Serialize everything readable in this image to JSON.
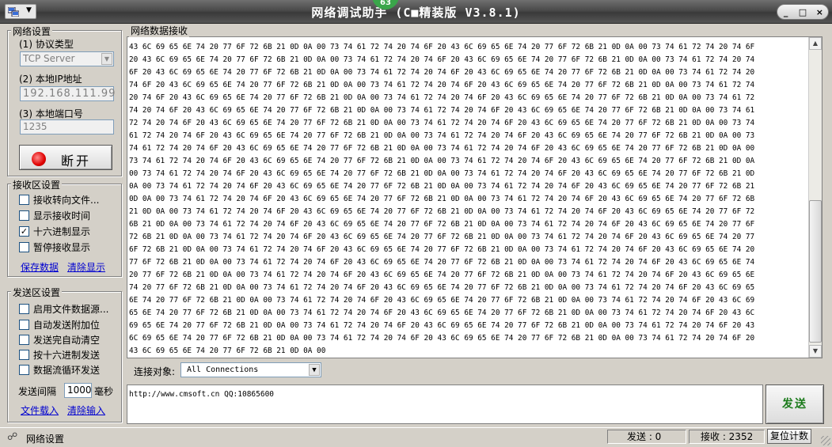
{
  "window": {
    "title": "网络调试助手 (C■精装版 V3.8.1)",
    "badge": "63",
    "min_glyph": "_",
    "max_glyph": "□",
    "close_glyph": "×"
  },
  "network": {
    "group_title": "网络设置",
    "protocol_label": "(1) 协议类型",
    "protocol_value": "TCP Server",
    "ip_label": "(2) 本地IP地址",
    "ip_value": "192.168.111.99",
    "port_label": "(3) 本地端口号",
    "port_value": "1235",
    "disconnect_label": "断开"
  },
  "receive_settings": {
    "group_title": "接收区设置",
    "options": [
      {
        "label": "接收转向文件...",
        "checked": false
      },
      {
        "label": "显示接收时间",
        "checked": false
      },
      {
        "label": "十六进制显示",
        "checked": true
      },
      {
        "label": "暂停接收显示",
        "checked": false
      }
    ],
    "save_link": "保存数据",
    "clear_link": "清除显示"
  },
  "send_settings": {
    "group_title": "发送区设置",
    "options": [
      {
        "label": "启用文件数据源...",
        "checked": false
      },
      {
        "label": "自动发送附加位",
        "checked": false
      },
      {
        "label": "发送完自动清空",
        "checked": false
      },
      {
        "label": "按十六进制发送",
        "checked": false
      },
      {
        "label": "数据流循环发送",
        "checked": false
      }
    ],
    "interval_label": "发送间隔",
    "interval_value": "1000",
    "interval_unit": "毫秒",
    "load_file_link": "文件载入",
    "clear_input_link": "清除输入"
  },
  "receive_area": {
    "title": "网络数据接收",
    "lines": [
      "43 6C 69 65 6E 74 20 77 6F 72 6B 21 0D 0A 00 73 74 61 72 74 20 74 6F 20 43 6C 69 65 6E 74 20 77 6F 72 6B 21 0D 0A 00 73 74 61 72 74 20 74 6F",
      "20 43 6C 69 65 6E 74 20 77 6F 72 6B 21 0D 0A 00 73 74 61 72 74 20 74 6F 20 43 6C 69 65 6E 74 20 77 6F 72 6B 21 0D 0A 00 73 74 61 72 74 20 74",
      "6F 20 43 6C 69 65 6E 74 20 77 6F 72 6B 21 0D 0A 00 73 74 61 72 74 20 74 6F 20 43 6C 69 65 6E 74 20 77 6F 72 6B 21 0D 0A 00 73 74 61 72 74 20",
      "74 6F 20 43 6C 69 65 6E 74 20 77 6F 72 6B 21 0D 0A 00 73 74 61 72 74 20 74 6F 20 43 6C 69 65 6E 74 20 77 6F 72 6B 21 0D 0A 00 73 74 61 72 74",
      "20 74 6F 20 43 6C 69 65 6E 74 20 77 6F 72 6B 21 0D 0A 00 73 74 61 72 74 20 74 6F 20 43 6C 69 65 6E 74 20 77 6F 72 6B 21 0D 0A 00 73 74 61 72",
      "74 20 74 6F 20 43 6C 69 65 6E 74 20 77 6F 72 6B 21 0D 0A 00 73 74 61 72 74 20 74 6F 20 43 6C 69 65 6E 74 20 77 6F 72 6B 21 0D 0A 00 73 74 61",
      "72 74 20 74 6F 20 43 6C 69 65 6E 74 20 77 6F 72 6B 21 0D 0A 00 73 74 61 72 74 20 74 6F 20 43 6C 69 65 6E 74 20 77 6F 72 6B 21 0D 0A 00 73 74",
      "61 72 74 20 74 6F 20 43 6C 69 65 6E 74 20 77 6F 72 6B 21 0D 0A 00 73 74 61 72 74 20 74 6F 20 43 6C 69 65 6E 74 20 77 6F 72 6B 21 0D 0A 00 73",
      "74 61 72 74 20 74 6F 20 43 6C 69 65 6E 74 20 77 6F 72 6B 21 0D 0A 00 73 74 61 72 74 20 74 6F 20 43 6C 69 65 6E 74 20 77 6F 72 6B 21 0D 0A 00",
      "73 74 61 72 74 20 74 6F 20 43 6C 69 65 6E 74 20 77 6F 72 6B 21 0D 0A 00 73 74 61 72 74 20 74 6F 20 43 6C 69 65 6E 74 20 77 6F 72 6B 21 0D 0A",
      "00 73 74 61 72 74 20 74 6F 20 43 6C 69 65 6E 74 20 77 6F 72 6B 21 0D 0A 00 73 74 61 72 74 20 74 6F 20 43 6C 69 65 6E 74 20 77 6F 72 6B 21 0D",
      "0A 00 73 74 61 72 74 20 74 6F 20 43 6C 69 65 6E 74 20 77 6F 72 6B 21 0D 0A 00 73 74 61 72 74 20 74 6F 20 43 6C 69 65 6E 74 20 77 6F 72 6B 21",
      "0D 0A 00 73 74 61 72 74 20 74 6F 20 43 6C 69 65 6E 74 20 77 6F 72 6B 21 0D 0A 00 73 74 61 72 74 20 74 6F 20 43 6C 69 65 6E 74 20 77 6F 72 6B",
      "21 0D 0A 00 73 74 61 72 74 20 74 6F 20 43 6C 69 65 6E 74 20 77 6F 72 6B 21 0D 0A 00 73 74 61 72 74 20 74 6F 20 43 6C 69 65 6E 74 20 77 6F 72",
      "6B 21 0D 0A 00 73 74 61 72 74 20 74 6F 20 43 6C 69 65 6E 74 20 77 6F 72 6B 21 0D 0A 00 73 74 61 72 74 20 74 6F 20 43 6C 69 65 6E 74 20 77 6F",
      "72 6B 21 0D 0A 00 73 74 61 72 74 20 74 6F 20 43 6C 69 65 6E 74 20 77 6F 72 6B 21 0D 0A 00 73 74 61 72 74 20 74 6F 20 43 6C 69 65 6E 74 20 77",
      "6F 72 6B 21 0D 0A 00 73 74 61 72 74 20 74 6F 20 43 6C 69 65 6E 74 20 77 6F 72 6B 21 0D 0A 00 73 74 61 72 74 20 74 6F 20 43 6C 69 65 6E 74 20",
      "77 6F 72 6B 21 0D 0A 00 73 74 61 72 74 20 74 6F 20 43 6C 69 65 6E 74 20 77 6F 72 6B 21 0D 0A 00 73 74 61 72 74 20 74 6F 20 43 6C 69 65 6E 74",
      "20 77 6F 72 6B 21 0D 0A 00 73 74 61 72 74 20 74 6F 20 43 6C 69 65 6E 74 20 77 6F 72 6B 21 0D 0A 00 73 74 61 72 74 20 74 6F 20 43 6C 69 65 6E",
      "74 20 77 6F 72 6B 21 0D 0A 00 73 74 61 72 74 20 74 6F 20 43 6C 69 65 6E 74 20 77 6F 72 6B 21 0D 0A 00 73 74 61 72 74 20 74 6F 20 43 6C 69 65",
      "6E 74 20 77 6F 72 6B 21 0D 0A 00 73 74 61 72 74 20 74 6F 20 43 6C 69 65 6E 74 20 77 6F 72 6B 21 0D 0A 00 73 74 61 72 74 20 74 6F 20 43 6C 69",
      "65 6E 74 20 77 6F 72 6B 21 0D 0A 00 73 74 61 72 74 20 74 6F 20 43 6C 69 65 6E 74 20 77 6F 72 6B 21 0D 0A 00 73 74 61 72 74 20 74 6F 20 43 6C",
      "69 65 6E 74 20 77 6F 72 6B 21 0D 0A 00 73 74 61 72 74 20 74 6F 20 43 6C 69 65 6E 74 20 77 6F 72 6B 21 0D 0A 00 73 74 61 72 74 20 74 6F 20 43",
      "6C 69 65 6E 74 20 77 6F 72 6B 21 0D 0A 00 73 74 61 72 74 20 74 6F 20 43 6C 69 65 6E 74 20 77 6F 72 6B 21 0D 0A 00 73 74 61 72 74 20 74 6F 20",
      "43 6C 69 65 6E 74 20 77 6F 72 6B 21 0D 0A 00"
    ]
  },
  "connection": {
    "label": "连接对象:",
    "value": "All Connections"
  },
  "send_area": {
    "text": "http://www.cmsoft.cn QQ:10865600",
    "send_label": "发送"
  },
  "status": {
    "text": "网络设置",
    "sent": "发送 : 0",
    "received": "接收 : 2352",
    "reset_label": "复位计数"
  }
}
